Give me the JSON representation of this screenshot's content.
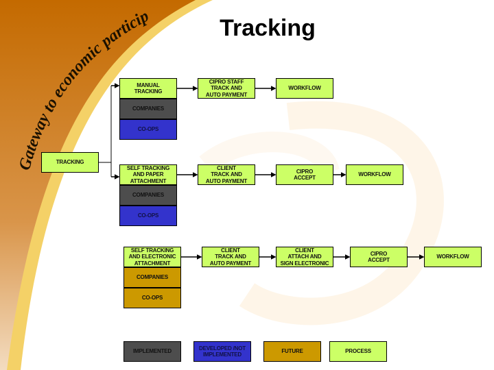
{
  "slide": {
    "title": "Tracking",
    "tagline": "Gateway to economic participation"
  },
  "colors": {
    "process": "#ccff66",
    "implemented": "#4d4d4d",
    "developed_not_implemented": "#3333cc",
    "future": "#cc9900",
    "banner_dark": "#c46a00",
    "banner_light": "#f2c94c"
  },
  "root": {
    "label": "TRACKING"
  },
  "rows": [
    {
      "name": "manual",
      "steps": [
        "MANUAL\nTRACKING",
        "CIPRO STAFF\nTRACK AND\nAUTO PAYMENT",
        "WORKFLOW"
      ],
      "companies": {
        "label": "COMPANIES",
        "status": "implemented"
      },
      "coops": {
        "label": "CO-OPS",
        "status": "developed_not_implemented"
      }
    },
    {
      "name": "self-paper",
      "steps": [
        "SELF TRACKING\nAND PAPER\nATTACHMENT",
        "CLIENT\nTRACK AND\nAUTO PAYMENT",
        "CIPRO\nACCEPT",
        "WORKFLOW"
      ],
      "companies": {
        "label": "COMPANIES",
        "status": "implemented"
      },
      "coops": {
        "label": "CO-OPS",
        "status": "developed_not_implemented"
      }
    },
    {
      "name": "self-electronic",
      "steps": [
        "SELF TRACKING\nAND ELECTRONIC\nATTACHMENT",
        "CLIENT\nTRACK AND\nAUTO PAYMENT",
        "CLIENT\nATTACH AND\nSIGN ELECTRONIC",
        "CIPRO\nACCEPT",
        "WORKFLOW"
      ],
      "companies": {
        "label": "COMPANIES",
        "status": "future"
      },
      "coops": {
        "label": "CO-OPS",
        "status": "future"
      }
    }
  ],
  "legend": [
    {
      "label": "IMPLEMENTED",
      "status": "implemented"
    },
    {
      "label": "DEVELOPED /NOT\nIMPLEMENTED",
      "status": "developed_not_implemented"
    },
    {
      "label": "FUTURE",
      "status": "future"
    },
    {
      "label": "PROCESS",
      "status": "process"
    }
  ]
}
